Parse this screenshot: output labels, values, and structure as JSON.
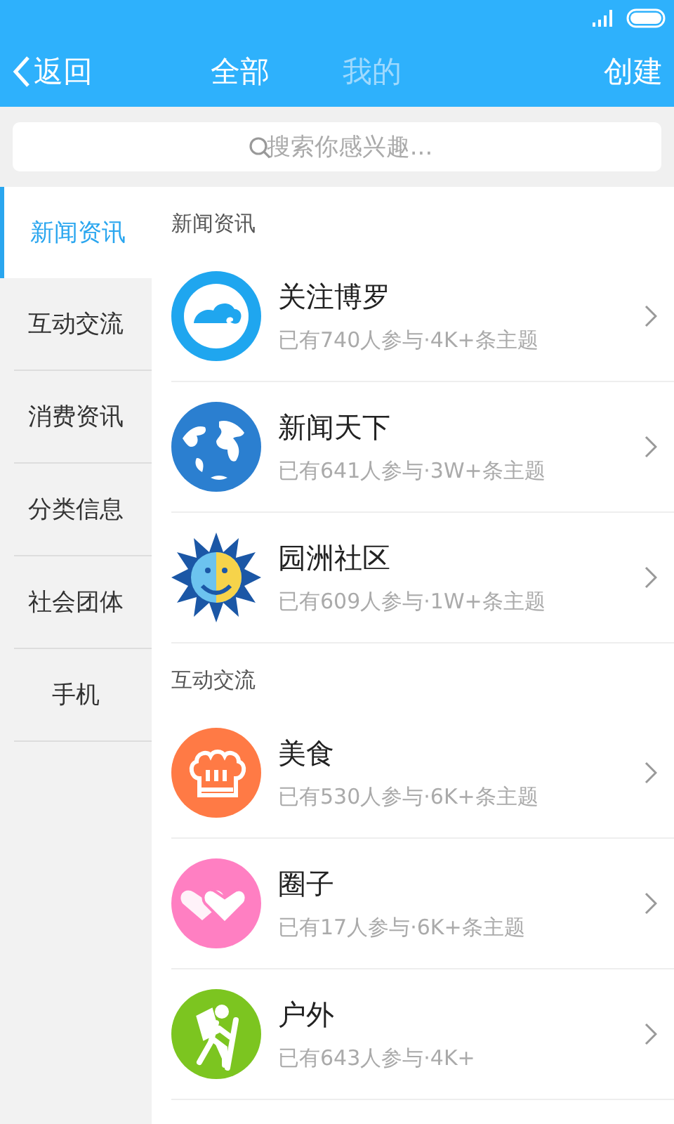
{
  "header": {
    "back": "返回",
    "tabs": [
      {
        "label": "全部",
        "selected": true
      },
      {
        "label": "我的",
        "selected": false
      }
    ],
    "action": "创建"
  },
  "search": {
    "placeholder": "搜索你感兴趣..."
  },
  "sidebar": {
    "items": [
      {
        "label": "新闻资讯",
        "selected": true
      },
      {
        "label": "互动交流",
        "selected": false
      },
      {
        "label": "消费资讯",
        "selected": false
      },
      {
        "label": "分类信息",
        "selected": false
      },
      {
        "label": "社会团体",
        "selected": false
      },
      {
        "label": "手机",
        "selected": false
      }
    ]
  },
  "sections": [
    {
      "title": "新闻资讯",
      "items": [
        {
          "name": "关注博罗",
          "info": "已有740人参与·4K+条主题"
        },
        {
          "name": "新闻天下",
          "info": "已有641人参与·3W+条主题"
        },
        {
          "name": "园洲社区",
          "info": "已有609人参与·1W+条主题"
        }
      ]
    },
    {
      "title": "互动交流",
      "items": [
        {
          "name": "美食",
          "info": "已有530人参与·6K+条主题"
        },
        {
          "name": "圈子",
          "info": "已有17人参与·6K+条主题"
        },
        {
          "name": "户外",
          "info": "已有643人参与·4K+"
        }
      ]
    }
  ]
}
